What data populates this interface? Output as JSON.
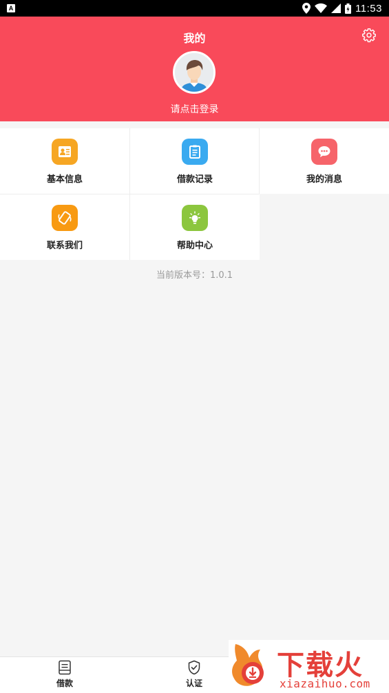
{
  "status_bar": {
    "notification_icon": "A",
    "time": "11:53"
  },
  "header": {
    "title": "我的",
    "login_prompt": "请点击登录",
    "background_color": "#f94a5a"
  },
  "menu": [
    {
      "label": "基本信息",
      "icon": "contact-card-icon",
      "color": "#f6a623"
    },
    {
      "label": "借款记录",
      "icon": "clipboard-icon",
      "color": "#3aaaf0"
    },
    {
      "label": "我的消息",
      "icon": "chat-bubble-icon",
      "color": "#f6646a"
    },
    {
      "label": "联系我们",
      "icon": "phone-icon",
      "color": "#f89a12"
    },
    {
      "label": "帮助中心",
      "icon": "lightbulb-icon",
      "color": "#8cc63e"
    }
  ],
  "version_text": "当前版本号：1.0.1",
  "bottom_nav": {
    "items": [
      {
        "label": "借款",
        "icon": "document-icon"
      },
      {
        "label": "认证",
        "icon": "shield-check-icon"
      }
    ]
  },
  "watermark": {
    "title": "下载火",
    "url": "xiazaihuo.com"
  }
}
